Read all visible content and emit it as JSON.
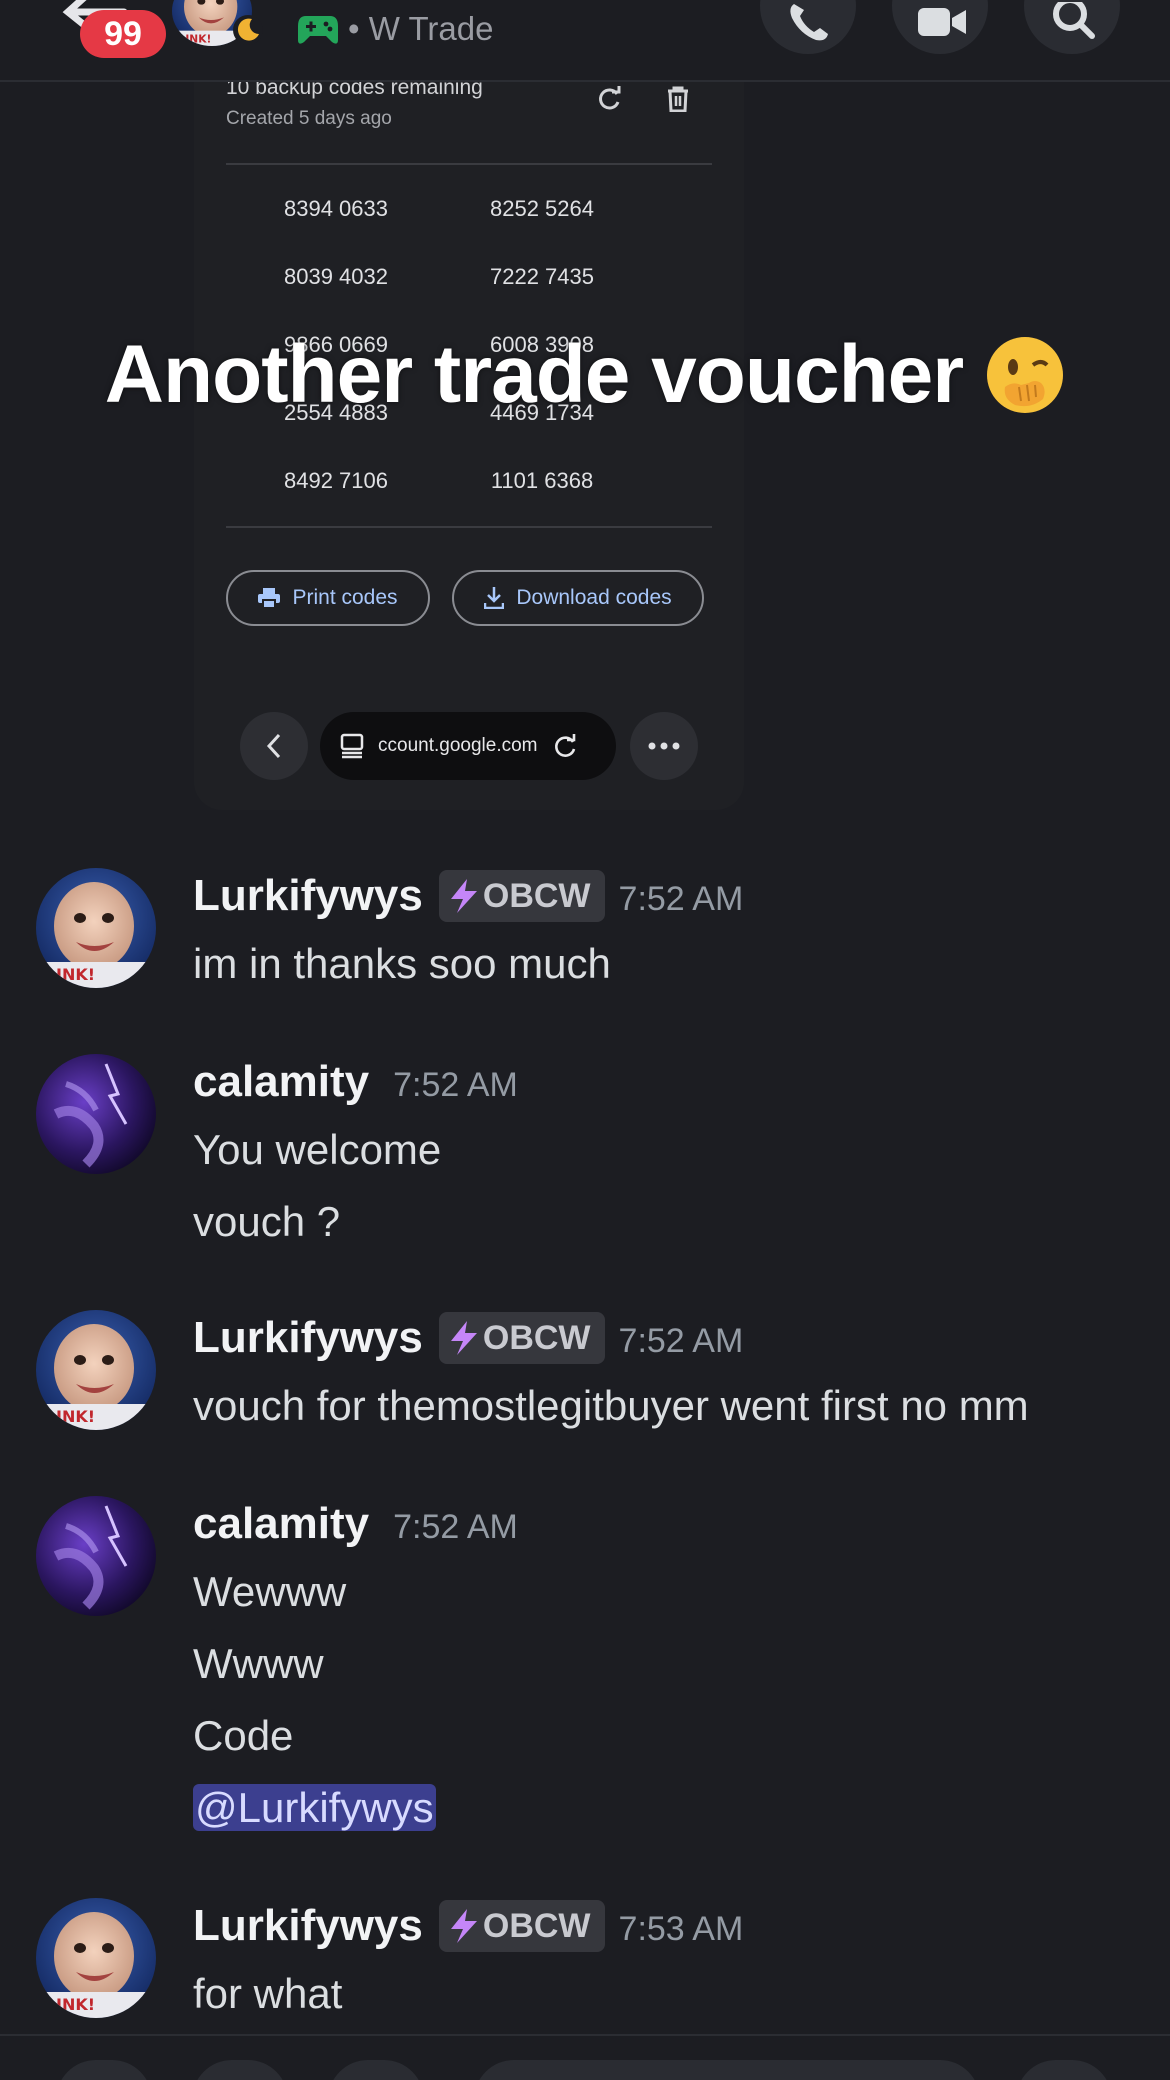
{
  "header": {
    "unread_count": "99",
    "channel_name": "• W Trade"
  },
  "embedded_screenshot": {
    "remaining": "10 backup codes remaining",
    "created": "Created 5 days ago",
    "codes": [
      [
        "8394 0633",
        "8252 5264"
      ],
      [
        "8039 4032",
        "7222 7435"
      ],
      [
        "9866 0669",
        "6008 3908"
      ],
      [
        "2554 4883",
        "4469 1734"
      ],
      [
        "8492 7106",
        "1101 6368"
      ]
    ],
    "print_label": "Print codes",
    "download_label": "Download codes",
    "url": "ccount.google.com"
  },
  "caption": {
    "text": "Another trade voucher",
    "emoji": "🫣"
  },
  "messages": [
    {
      "user": "Lurkifywys",
      "tag": "OBCW",
      "time": "7:52 AM",
      "lines": [
        "im in thanks soo much"
      ]
    },
    {
      "user": "calamity",
      "time": "7:52 AM",
      "lines": [
        "You welcome",
        "vouch ?"
      ]
    },
    {
      "user": "Lurkifywys",
      "tag": "OBCW",
      "time": "7:52 AM",
      "lines": [
        "vouch for themostlegitbuyer went first no mm"
      ]
    },
    {
      "user": "calamity",
      "time": "7:52 AM",
      "lines": [
        "Wewww",
        "Wwww",
        "Code"
      ],
      "mention": "@Lurkifywys"
    },
    {
      "user": "Lurkifywys",
      "tag": "OBCW",
      "time": "7:53 AM",
      "lines": [
        "for what"
      ]
    }
  ],
  "colors": {
    "background": "#1c1d22",
    "badge": "#e53945",
    "link_blue": "#a8c7fa",
    "mention_bg": "#3c3f8f",
    "tag_bolt": "#c586f8"
  },
  "icons": [
    "back-arrow-icon",
    "moon-icon",
    "controller-icon",
    "phone-icon",
    "video-icon",
    "search-icon",
    "refresh-icon",
    "trash-icon",
    "printer-icon",
    "download-icon",
    "chevron-left-icon",
    "tabs-icon",
    "reload-icon",
    "more-icon",
    "bolt-icon"
  ]
}
